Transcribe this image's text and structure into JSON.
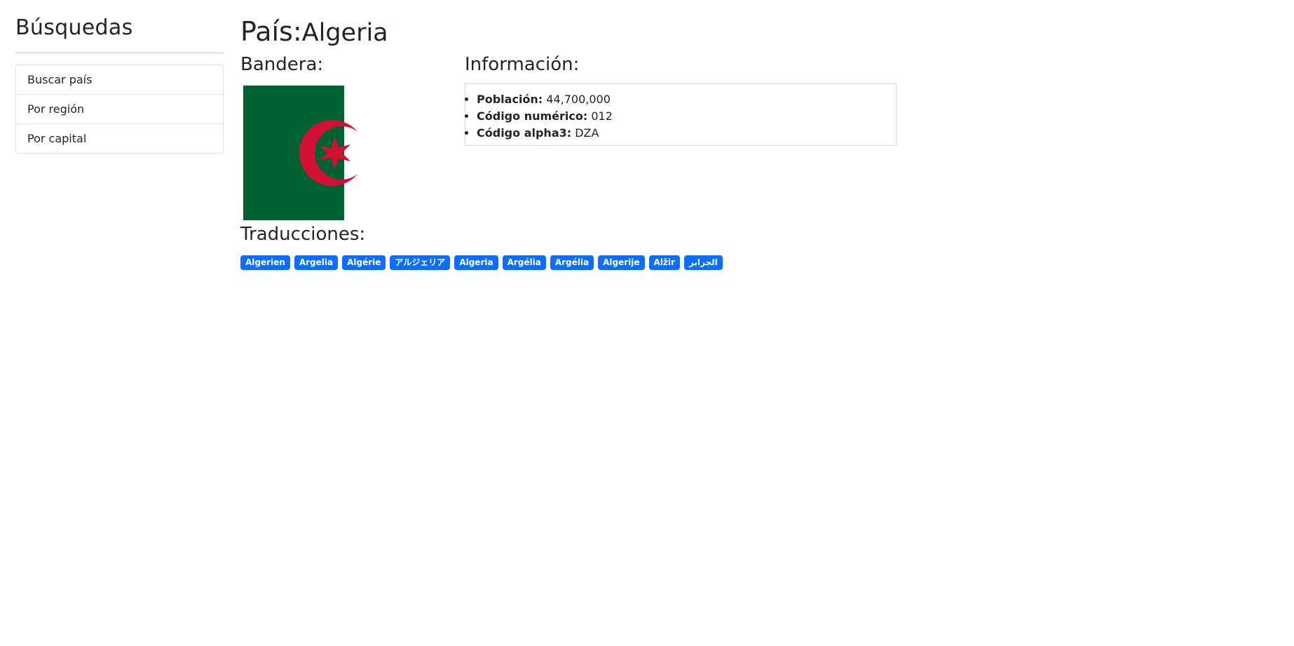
{
  "sidebar": {
    "title": "Búsquedas",
    "items": [
      {
        "label": "Buscar país"
      },
      {
        "label": "Por región"
      },
      {
        "label": "Por capital"
      }
    ]
  },
  "country": {
    "title_label": "País:",
    "name": "Algeria",
    "flag_title": "Bandera:",
    "info_title": "Información:",
    "info": [
      {
        "label": "Población:",
        "value": "44,700,000"
      },
      {
        "label": "Código numérico:",
        "value": "012"
      },
      {
        "label": "Código alpha3:",
        "value": "DZA"
      }
    ],
    "translations_title": "Traducciones:",
    "translations": [
      "Algerien",
      "Argelia",
      "Algérie",
      "アルジェリア",
      "Algeria",
      "Argélia",
      "Argélia",
      "Algerije",
      "Alžir",
      "الجزاير"
    ]
  },
  "colors": {
    "flag_green": "#006233",
    "flag_red": "#d21034",
    "badge": "#0d6efd"
  },
  "icons": {
    "flag": "algeria-flag"
  }
}
